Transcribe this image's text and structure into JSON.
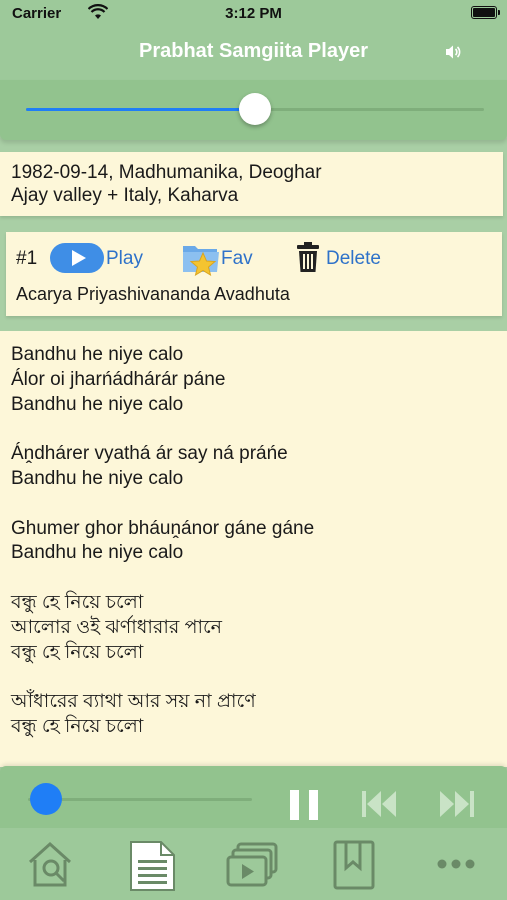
{
  "status": {
    "carrier": "Carrier",
    "time": "3:12 PM"
  },
  "nav": {
    "title": "Prabhat Samgiita Player",
    "speaker_icon": "speaker-icon"
  },
  "volume": {
    "level": 0.5
  },
  "info": {
    "line1": "1982-09-14, Madhumanika, Deoghar",
    "line2": "Ajay valley + Italy, Kaharva"
  },
  "track": {
    "number": "#1",
    "play_label": "Play",
    "fav_label": "Fav",
    "delete_label": "Delete",
    "artist": "Acarya Priyashivananda Avadhuta"
  },
  "lyrics": [
    "Bandhu he niye calo",
    "Álor oi jharńádhárár páne",
    "Bandhu he niye calo",
    "",
    "Áṋdhárer vyathá ár say ná práńe",
    "Bandhu he niye calo",
    "",
    "Ghumer ghor bháuṋánor gáne gáne",
    "Bandhu he niye calo",
    "",
    "বন্ধু হে নিয়ে চলো",
    "আলোর ওই ঝর্ণাধারার পানে",
    "বন্ধু হে নিয়ে চলো",
    "",
    "আঁধারের ব্যাথা আর সয় না প্রাণে",
    "বন্ধু হে নিয়ে চলো"
  ],
  "player": {
    "progress": 0.08
  },
  "tabs": [
    "home-search-icon",
    "document-icon",
    "playlist-video-icon",
    "bookmark-icon",
    "more-icon"
  ],
  "colors": {
    "accent": "#1f7ef6",
    "bar": "#9dc99a",
    "card": "#fdf7d9",
    "link": "#2e72c9"
  }
}
